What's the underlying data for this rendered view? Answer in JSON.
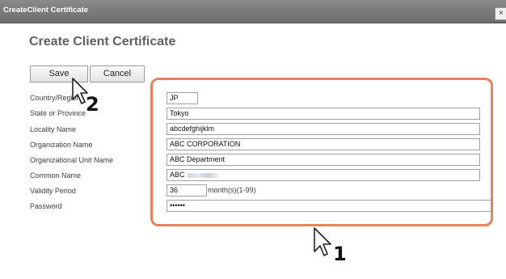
{
  "window": {
    "title": "CreateClient Certificate",
    "close_glyph": "×"
  },
  "page": {
    "heading": "Create Client Certificate"
  },
  "toolbar": {
    "save_label": "Save",
    "cancel_label": "Cancel"
  },
  "form": {
    "labels": {
      "country": "Country/Region",
      "state": "State or Province",
      "locality": "Locality Name",
      "organization": "Organization Name",
      "org_unit": "Organizational Unit Name",
      "common_name": "Common Name",
      "validity": "Validity Period",
      "password": "Password"
    },
    "values": {
      "country": "JP",
      "state": "Tokyo",
      "locality": "abcdefghijklm",
      "organization": "ABC CORPORATION",
      "org_unit": "ABC Department",
      "common_name": "ABC",
      "validity": "36",
      "password": "••••••"
    },
    "validity_suffix": "month(s)(1-99)"
  },
  "annotations": {
    "step1": "1",
    "step2": "2",
    "highlight_color": "#e8835f"
  },
  "icons": [
    "close-icon",
    "mouse-cursor-icon"
  ]
}
